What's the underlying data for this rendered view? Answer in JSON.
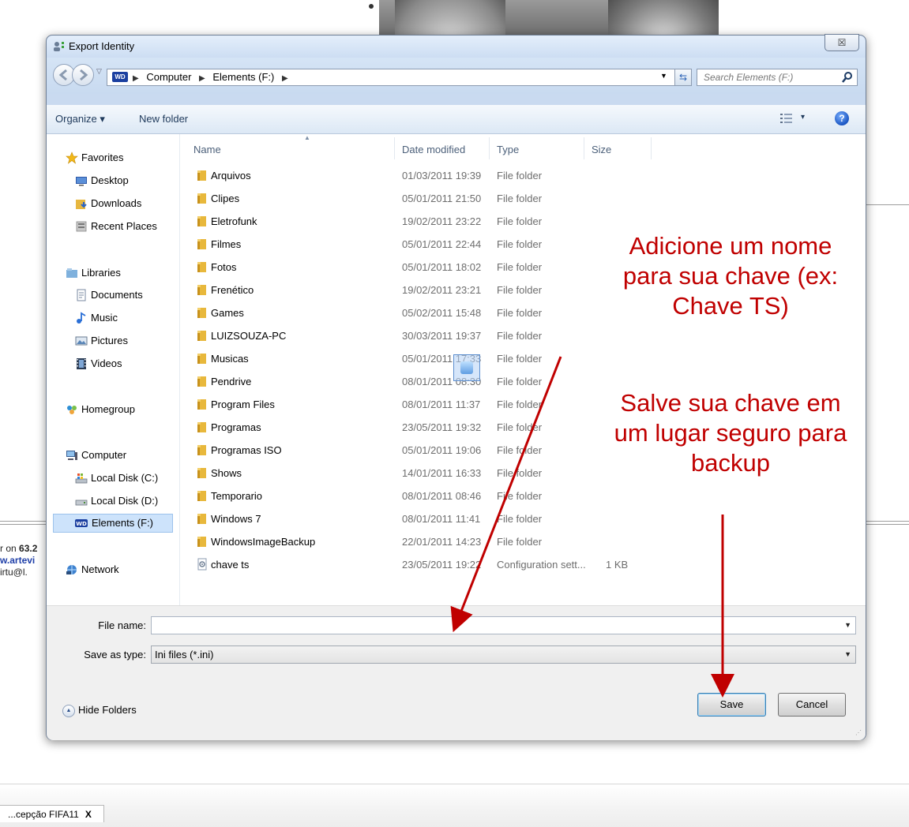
{
  "background": {
    "left_text": {
      "line1_prefix": "r on ",
      "line1_bold": "63.2",
      "line2": "w.artevi",
      "line3": "irtu@l."
    },
    "bottom_tab": {
      "label": "...cepção FIFA11",
      "close": "X"
    }
  },
  "dialog": {
    "title": "Export Identity",
    "close_glyph": "☒",
    "address": {
      "drive_badge": "WD",
      "crumbs": [
        "Computer",
        "Elements (F:)"
      ]
    },
    "search": {
      "placeholder": "Search Elements (F:)"
    },
    "toolbar": {
      "organize": "Organize ▾",
      "new_folder": "New folder",
      "view_arrow": "▾",
      "help": "?"
    },
    "nav": {
      "favorites": {
        "header": "Favorites",
        "items": [
          "Desktop",
          "Downloads",
          "Recent Places"
        ]
      },
      "libraries": {
        "header": "Libraries",
        "items": [
          "Documents",
          "Music",
          "Pictures",
          "Videos"
        ]
      },
      "homegroup": "Homegroup",
      "computer": {
        "header": "Computer",
        "items": [
          "Local Disk (C:)",
          "Local Disk (D:)",
          "Elements (F:)"
        ],
        "selected": "Elements (F:)"
      },
      "network": "Network"
    },
    "columns": {
      "name": "Name",
      "date": "Date modified",
      "type": "Type",
      "size": "Size"
    },
    "files": [
      {
        "name": "Arquivos",
        "date": "01/03/2011 19:39",
        "type": "File folder",
        "size": ""
      },
      {
        "name": "Clipes",
        "date": "05/01/2011 21:50",
        "type": "File folder",
        "size": ""
      },
      {
        "name": "Eletrofunk",
        "date": "19/02/2011 23:22",
        "type": "File folder",
        "size": ""
      },
      {
        "name": "Filmes",
        "date": "05/01/2011 22:44",
        "type": "File folder",
        "size": ""
      },
      {
        "name": "Fotos",
        "date": "05/01/2011 18:02",
        "type": "File folder",
        "size": ""
      },
      {
        "name": "Frenético",
        "date": "19/02/2011 23:21",
        "type": "File folder",
        "size": ""
      },
      {
        "name": "Games",
        "date": "05/02/2011 15:48",
        "type": "File folder",
        "size": ""
      },
      {
        "name": "LUIZSOUZA-PC",
        "date": "30/03/2011 19:37",
        "type": "File folder",
        "size": ""
      },
      {
        "name": "Musicas",
        "date": "05/01/2011 17:33",
        "type": "File folder",
        "size": ""
      },
      {
        "name": "Pendrive",
        "date": "08/01/2011 08:30",
        "type": "File folder",
        "size": ""
      },
      {
        "name": "Program Files",
        "date": "08/01/2011 11:37",
        "type": "File folder",
        "size": ""
      },
      {
        "name": "Programas",
        "date": "23/05/2011 19:32",
        "type": "File folder",
        "size": ""
      },
      {
        "name": "Programas ISO",
        "date": "05/01/2011 19:06",
        "type": "File folder",
        "size": ""
      },
      {
        "name": "Shows",
        "date": "14/01/2011 16:33",
        "type": "File folder",
        "size": ""
      },
      {
        "name": "Temporario",
        "date": "08/01/2011 08:46",
        "type": "File folder",
        "size": ""
      },
      {
        "name": "Windows 7",
        "date": "08/01/2011 11:41",
        "type": "File folder",
        "size": ""
      },
      {
        "name": "WindowsImageBackup",
        "date": "22/01/2011 14:23",
        "type": "File folder",
        "size": ""
      },
      {
        "name": "chave ts",
        "date": "23/05/2011 19:22",
        "type": "Configuration sett...",
        "size": "1 KB"
      }
    ],
    "file_name": {
      "label": "File name:",
      "value": ""
    },
    "save_as_type": {
      "label": "Save as type:",
      "value": "Ini files (*.ini)"
    },
    "hide_folders": "Hide Folders",
    "buttons": {
      "save": "Save",
      "cancel": "Cancel"
    }
  },
  "annotations": {
    "text1": [
      "Adicione um nome",
      "para sua chave (ex:",
      "Chave TS)"
    ],
    "text2": [
      "Salve sua chave em",
      "um lugar seguro para",
      "backup"
    ],
    "color": "#c00000"
  }
}
